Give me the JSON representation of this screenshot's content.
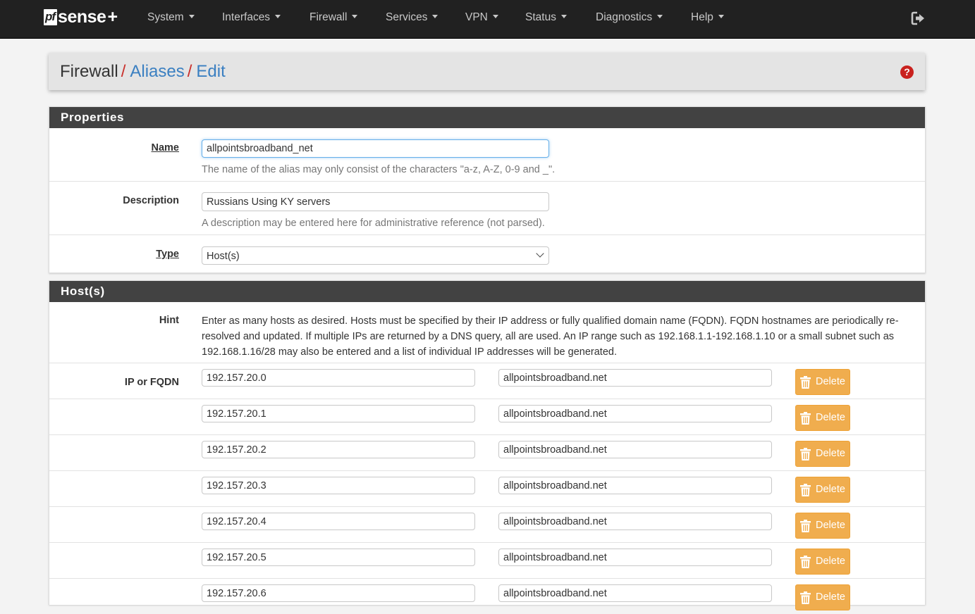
{
  "brand": {
    "pf": "pf",
    "sense": "sense",
    "plus": "+"
  },
  "nav": {
    "items": [
      {
        "label": "System"
      },
      {
        "label": "Interfaces"
      },
      {
        "label": "Firewall"
      },
      {
        "label": "Services"
      },
      {
        "label": "VPN"
      },
      {
        "label": "Status"
      },
      {
        "label": "Diagnostics"
      },
      {
        "label": "Help"
      }
    ],
    "logout_icon": "sign-out-icon"
  },
  "breadcrumb": {
    "part1": "Firewall",
    "part2": "Aliases",
    "part3": "Edit",
    "separator": "/"
  },
  "help_icon": "?",
  "properties": {
    "heading": "Properties",
    "name": {
      "label": "Name",
      "value": "allpointsbroadband_net",
      "help": "The name of the alias may only consist of the characters \"a-z, A-Z, 0-9 and _\"."
    },
    "description": {
      "label": "Description",
      "value": "Russians Using KY servers",
      "help": "A description may be entered here for administrative reference (not parsed)."
    },
    "type": {
      "label": "Type",
      "value": "Host(s)"
    }
  },
  "hosts": {
    "heading": "Host(s)",
    "hint_label": "Hint",
    "hint": "Enter as many hosts as desired. Hosts must be specified by their IP address or fully qualified domain name (FQDN). FQDN hostnames are periodically re-resolved and updated. If multiple IPs are returned by a DNS query, all are used. An IP range such as 192.168.1.1-192.168.1.10 or a small subnet such as 192.168.1.16/28 may also be entered and a list of individual IP addresses will be generated.",
    "ip_label": "IP or FQDN",
    "delete_label": "Delete",
    "entries": [
      {
        "ip": "192.157.20.0",
        "desc": "allpointsbroadband.net"
      },
      {
        "ip": "192.157.20.1",
        "desc": "allpointsbroadband.net"
      },
      {
        "ip": "192.157.20.2",
        "desc": "allpointsbroadband.net"
      },
      {
        "ip": "192.157.20.3",
        "desc": "allpointsbroadband.net"
      },
      {
        "ip": "192.157.20.4",
        "desc": "allpointsbroadband.net"
      },
      {
        "ip": "192.157.20.5",
        "desc": "allpointsbroadband.net"
      },
      {
        "ip": "192.157.20.6",
        "desc": "allpointsbroadband.net"
      }
    ]
  },
  "colors": {
    "navbar": "#212121",
    "panel_heading": "#424242",
    "link": "#3a7fc1",
    "separator": "#c9302c",
    "warning_button": "#f0ad4e"
  }
}
